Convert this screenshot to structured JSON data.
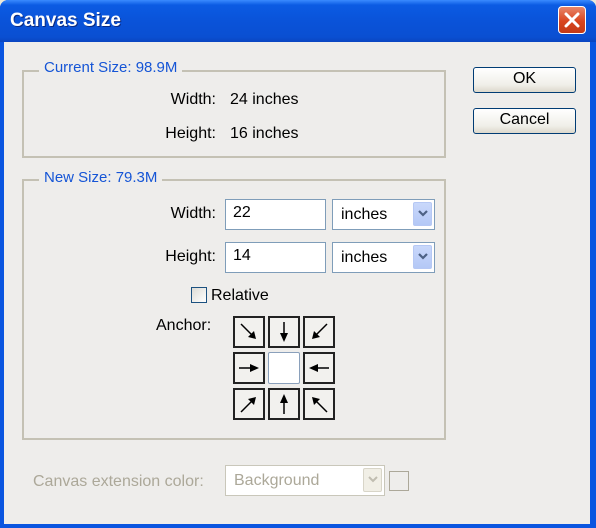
{
  "window": {
    "title": "Canvas Size",
    "close_icon": "close-x-icon"
  },
  "current_size": {
    "legend": "Current Size: 98.9M",
    "width_label": "Width:",
    "width_value": "24 inches",
    "height_label": "Height:",
    "height_value": "16 inches"
  },
  "new_size": {
    "legend": "New Size: 79.3M",
    "width_label": "Width:",
    "width_value": "22",
    "width_unit": "inches",
    "height_label": "Height:",
    "height_value": "14",
    "height_unit": "inches",
    "relative_label": "Relative",
    "relative_checked": false,
    "anchor_label": "Anchor:",
    "anchor_selected": "center",
    "anchor_arrows": [
      "arrow-down-right-icon",
      "arrow-down-icon",
      "arrow-down-left-icon",
      "arrow-right-icon",
      "",
      "arrow-left-icon",
      "arrow-up-right-icon",
      "arrow-up-icon",
      "arrow-up-left-icon"
    ]
  },
  "extension": {
    "label": "Canvas extension color:",
    "value": "Background",
    "enabled": false
  },
  "buttons": {
    "ok": "OK",
    "cancel": "Cancel"
  },
  "colors": {
    "title_bar": "#0a53d9",
    "legend_text": "#1555d6",
    "close_button": "#d9451f"
  }
}
